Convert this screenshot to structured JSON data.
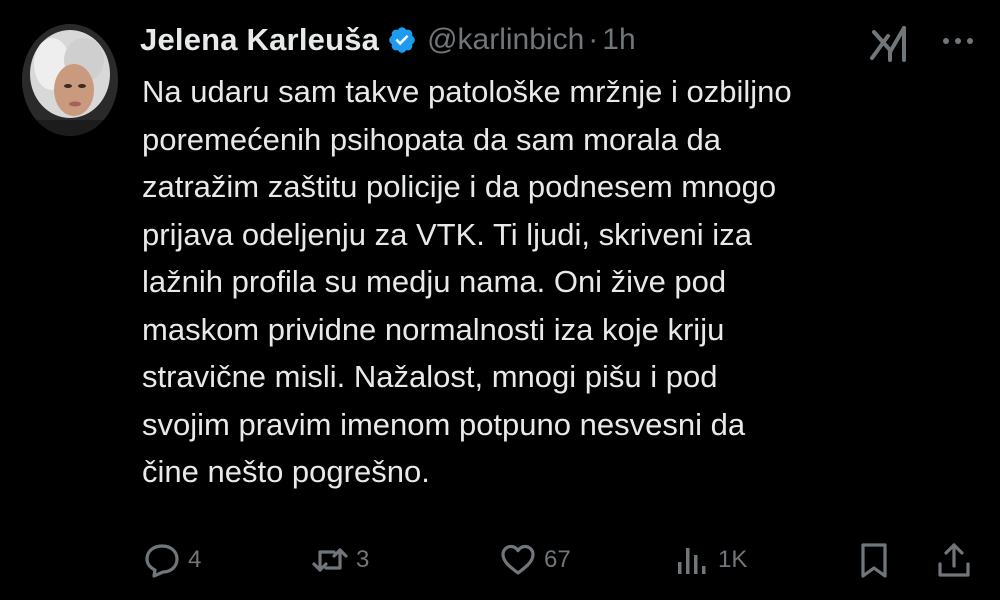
{
  "tweet": {
    "display_name": "Jelena Karleuša",
    "handle": "@karlinbich",
    "separator": "·",
    "time": "1h",
    "text": "Na udaru sam takve patološke mržnje i ozbiljno\nporemećenih psihopata da sam morala da\nzatražim zaštitu policije i da podnesem mnogo\nprijava odeljenju za VTK. Ti ljudi, skriveni iza\nlažnih profila su medju nama. Oni žive pod\nmaskom prividne normalnosti iza koje kriju\nstravične misli. Nažalost, mnogi pišu i pod\nsvojim pravim imenom potpuno nesvesni da\nčine nešto pogrešno."
  },
  "actions": {
    "reply_count": "4",
    "repost_count": "3",
    "like_count": "67",
    "views_count": "1K"
  },
  "icons": {
    "verified": "verified-badge-icon",
    "grok": "grok-icon",
    "more": "more-options-icon",
    "reply": "reply-icon",
    "repost": "repost-icon",
    "like": "heart-icon",
    "views": "views-icon",
    "bookmark": "bookmark-icon",
    "share": "share-icon"
  },
  "colors": {
    "background": "#000000",
    "text_primary": "#e7e9ea",
    "text_secondary": "#71767b",
    "verified_blue": "#1d9bf0"
  }
}
